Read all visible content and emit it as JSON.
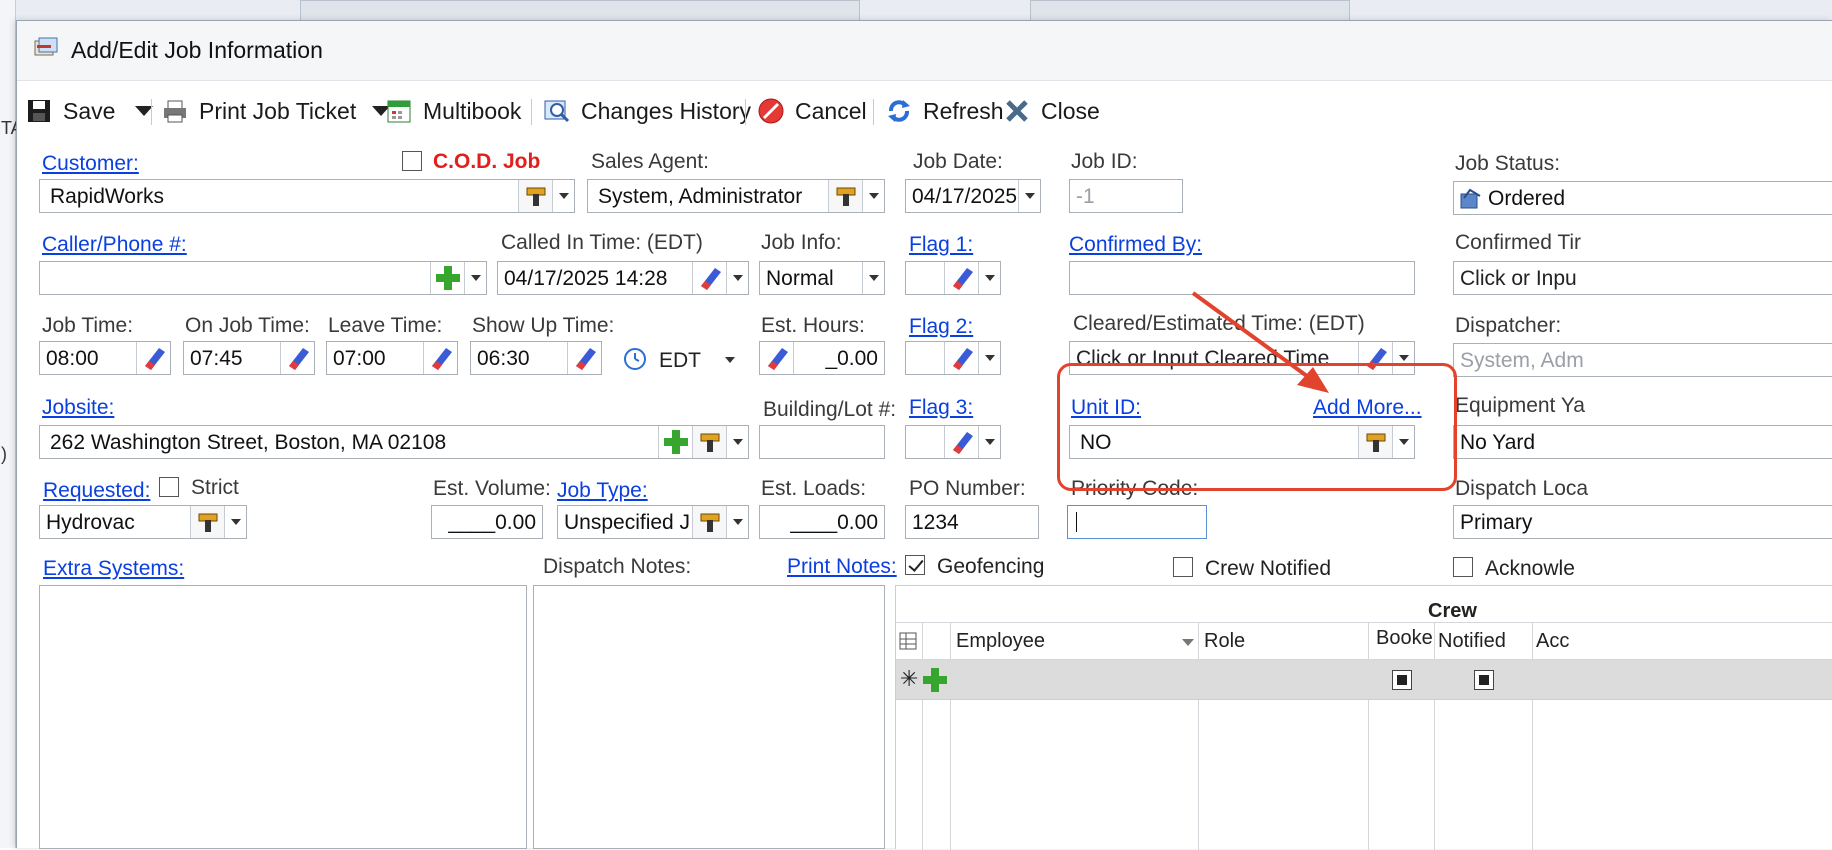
{
  "window": {
    "title": "Add/Edit Job Information"
  },
  "toolbar": {
    "save": "Save",
    "print_ticket": "Print Job Ticket",
    "multibook": "Multibook",
    "changes_history": "Changes History",
    "cancel": "Cancel",
    "refresh": "Refresh",
    "close": "Close"
  },
  "customer": {
    "label": "Customer:",
    "value": "RapidWorks",
    "cod_label": "C.O.D. Job",
    "cod_checked": false
  },
  "sales_agent": {
    "label": "Sales Agent:",
    "value": "System, Administrator"
  },
  "job_date": {
    "label": "Job Date:",
    "value": "04/17/2025"
  },
  "job_id": {
    "label": "Job ID:",
    "value": "-1"
  },
  "job_status": {
    "label": "Job Status:",
    "value": "Ordered"
  },
  "caller": {
    "label": "Caller/Phone #:",
    "value": ""
  },
  "called_in_time": {
    "label": "Called In Time: (EDT)",
    "value": "04/17/2025 14:28"
  },
  "job_info": {
    "label": "Job Info:",
    "value": "Normal"
  },
  "flag1": {
    "label": "Flag 1:"
  },
  "confirmed_by": {
    "label": "Confirmed By:",
    "value": ""
  },
  "confirmed_time": {
    "label": "Confirmed Tir",
    "placeholder": "Click or Inpu"
  },
  "times": {
    "job_time_label": "Job Time:",
    "job_time": "08:00",
    "on_job_label": "On Job Time:",
    "on_job": "07:45",
    "leave_label": "Leave Time:",
    "leave": "07:00",
    "show_up_label": "Show Up Time:",
    "show_up": "06:30",
    "timezone": "EDT"
  },
  "est_hours": {
    "label": "Est. Hours:",
    "value": "_0.00"
  },
  "flag2": {
    "label": "Flag 2:"
  },
  "cleared_time": {
    "label": "Cleared/Estimated Time: (EDT)",
    "placeholder": "Click or Input Cleared Time"
  },
  "dispatcher": {
    "label": "Dispatcher:",
    "value": "System, Adm"
  },
  "jobsite": {
    "label": "Jobsite:",
    "value": "262 Washington Street, Boston, MA 02108"
  },
  "building_lot": {
    "label": "Building/Lot #:",
    "value": ""
  },
  "flag3": {
    "label": "Flag 3:"
  },
  "unit_id": {
    "label": "Unit ID:",
    "add_more": "Add More...",
    "value": "NO"
  },
  "equipment_yard": {
    "label": "Equipment Ya",
    "value": "No Yard"
  },
  "requested": {
    "label": "Requested:",
    "strict_label": "Strict",
    "value": "Hydrovac"
  },
  "est_volume": {
    "label": "Est. Volume:",
    "value": "____0.00"
  },
  "job_type": {
    "label": "Job Type:",
    "value": "Unspecified J"
  },
  "est_loads": {
    "label": "Est. Loads:",
    "value": "____0.00"
  },
  "po_number": {
    "label": "PO Number:",
    "value": "1234"
  },
  "priority_code": {
    "label": "Priority Code:",
    "value": ""
  },
  "dispatch_location": {
    "label": "Dispatch Loca",
    "value": "Primary"
  },
  "extra_systems": {
    "label": "Extra Systems:"
  },
  "dispatch_notes": {
    "label": "Dispatch Notes:",
    "print_notes": "Print Notes:"
  },
  "options": {
    "geofencing": "Geofencing",
    "geofencing_checked": true,
    "crew_notified": "Crew Notified",
    "crew_notified_checked": false,
    "acknowledged": "Acknowle",
    "acknowledged_checked": false
  },
  "crew": {
    "title": "Crew",
    "columns": [
      "Employee",
      "Role",
      "Booke",
      "Notified",
      "Acc"
    ]
  },
  "background": {
    "left_chars": [
      "TA",
      ")"
    ]
  },
  "colors": {
    "link": "#0a3fe0",
    "cod": "#e0201e",
    "highlight": "#e2432c"
  }
}
